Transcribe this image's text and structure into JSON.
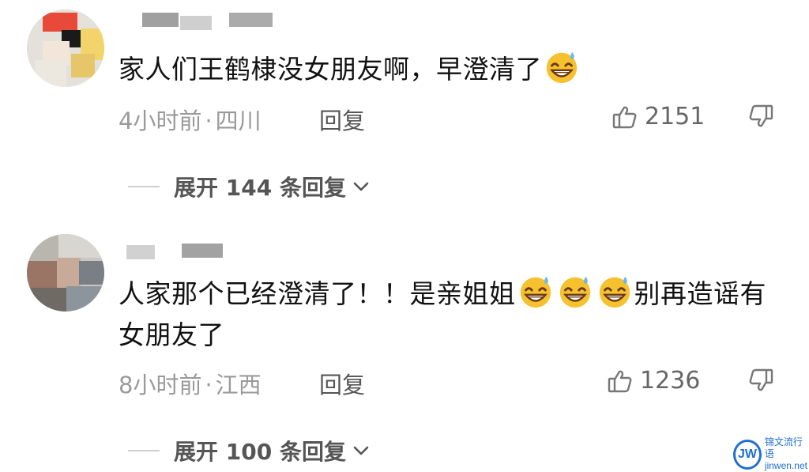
{
  "comments": [
    {
      "text_parts": [
        "家人们王鹤棣没女朋友啊，早澄清了"
      ],
      "time": "4小时前",
      "location": "四川",
      "reply_label": "回复",
      "likes": "2151",
      "expand_label": "展开 144 条回复"
    },
    {
      "text_parts": [
        "人家那个已经澄清了！！是亲姐姐",
        "别再造谣有女朋友了"
      ],
      "time": "8小时前",
      "location": "江西",
      "reply_label": "回复",
      "likes": "1236",
      "expand_label": "展开 100 条回复"
    }
  ],
  "separator": "·",
  "icons": {
    "emoji": "grinning-sweat-emoji",
    "like": "thumbs-up-icon",
    "dislike": "thumbs-down-icon",
    "expand": "chevron-down-icon"
  },
  "watermark": {
    "logo": "JW",
    "line1": "锦文流行语",
    "line2": "jinwen.net"
  },
  "colors": {
    "text": "#111111",
    "meta": "#999999",
    "reply": "#555555",
    "emoji_face": "#f6c12e",
    "watermark": "#1f6fd0"
  }
}
